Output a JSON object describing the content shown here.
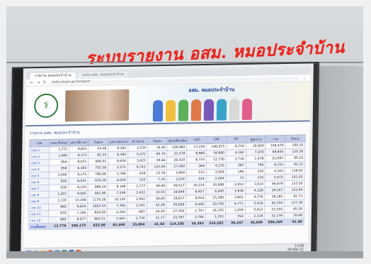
{
  "handwritten_caption": "ระบบรายงาน อสม. หมอประจำบ้าน",
  "browser": {
    "tabs": [
      "รายงาน หมอประจำบ้าน",
      "ระบบ อสม. หมอประจำบ้าน"
    ],
    "url": "hs4u.moph.go.th/report"
  },
  "banner": {
    "title": "อสม. หมอประจำบ้าน"
  },
  "content_title": "รายงาน อสม. หมอประจำบ้าน",
  "table": {
    "headers": [
      "เขต",
      "อสม.ทั้งหมด",
      "อสม.ที่ผ่านการอบรม",
      "ร้อยละ",
      "อสม.หมอประจำบ้าน",
      "เป้าหมาย",
      "ร้อยละ",
      "ผู้ป่วยติดเตียง",
      "CKD",
      "DM",
      "HT",
      "ผู้สูงอายุ",
      "รวม",
      "ร้อยละ"
    ],
    "rows": [
      {
        "label": "เขต 1",
        "cells": [
          "1,772",
          "9,651",
          "54.46",
          "9,262",
          "3,234",
          "34.92",
          "108,960",
          "17,230",
          "146,015",
          "8,716",
          "16,920",
          "156,470",
          "100.10"
        ]
      },
      {
        "label": "เขต 2",
        "cells": [
          "1,448",
          "9,173",
          "63.35",
          "6,382",
          "5,472",
          "85.74",
          "23,578",
          "9,960",
          "34,680",
          "4,162",
          "7,070",
          "69,850",
          "120.38"
        ]
      },
      {
        "label": "เขต 3",
        "cells": [
          "954",
          "8,071",
          "846.01",
          "8,630",
          "3,423",
          "39.66",
          "26,420",
          "8,714",
          "12,730",
          "2,716",
          "1,478",
          "21,097",
          "95.19"
        ]
      },
      {
        "label": "เขต 4",
        "cells": [
          "858",
          "6,483",
          "755.59",
          "5,571",
          "6,743",
          "121.04",
          "27,400",
          "369",
          "4,270",
          "397",
          "746",
          "6,152",
          "82.23"
        ]
      },
      {
        "label": "เขต 5",
        "cells": [
          "1,040",
          "8,175",
          "786.06",
          "2,780",
          "438",
          "15.76",
          "3,904",
          "153",
          "3,958",
          "190",
          "518",
          "4,343",
          "118.91"
        ]
      },
      {
        "label": "เขต 6",
        "cells": [
          "820",
          "8,031",
          "979.39",
          "4,619",
          "335",
          "7.25",
          "3,254",
          "414",
          "2,064",
          "73",
          "270",
          "5,073",
          "101.83"
        ]
      },
      {
        "label": "เขต 7",
        "cells": [
          "938",
          "8,125",
          "866.20",
          "9,349",
          "3,777",
          "40.40",
          "49,517",
          "10,214",
          "20,990",
          "5,914",
          "3,514",
          "96,879",
          "123.50"
        ]
      },
      {
        "label": "เขต 8",
        "cells": [
          "1,003",
          "9,045",
          "901.80",
          "7,249",
          "2,432",
          "33.55",
          "18,844",
          "6,827",
          "6,045",
          "5,936",
          "4,328",
          "39,347",
          "122.64"
        ]
      },
      {
        "label": "เขต 9",
        "cells": [
          "1,120",
          "13,108",
          "1170.36",
          "10,150",
          "2,842",
          "28.00",
          "18,617",
          "8,014",
          "15,580",
          "3,601",
          "4,776",
          "39,191",
          "91.73"
        ]
      },
      {
        "label": "เขต 10",
        "cells": [
          "960",
          "9,634",
          "1003.54",
          "7,700",
          "3,341",
          "43.39",
          "45,000",
          "9,456",
          "20,750",
          "4,771",
          "5,416",
          "62,334",
          "127.38"
        ]
      },
      {
        "label": "เขต 11",
        "cells": [
          "870",
          "7,100",
          "816.09",
          "4,240",
          "687",
          "16.20",
          "27,300",
          "1,757",
          "16,745",
          "1,259",
          "5,412",
          "23,355",
          "85.58"
        ]
      },
      {
        "label": "เขต 12",
        "cells": [
          "995",
          "9,577",
          "962.51",
          "5,563",
          "1,734",
          "31.17",
          "23,787",
          "3,794",
          "3,703",
          "754",
          "2,118",
          "32,178",
          "78.48"
        ]
      }
    ],
    "total": {
      "label": "รวมทั้งหมด",
      "cells": [
        "12,778",
        "105,173",
        "823.08",
        "81,495",
        "33,864",
        "41.55",
        "114,195",
        "35,383",
        "224,203",
        "36,247",
        "45,696",
        "556,269",
        "91.00"
      ]
    }
  },
  "taskbar": {
    "time": "13:06",
    "date": "09-Mar-21"
  }
}
